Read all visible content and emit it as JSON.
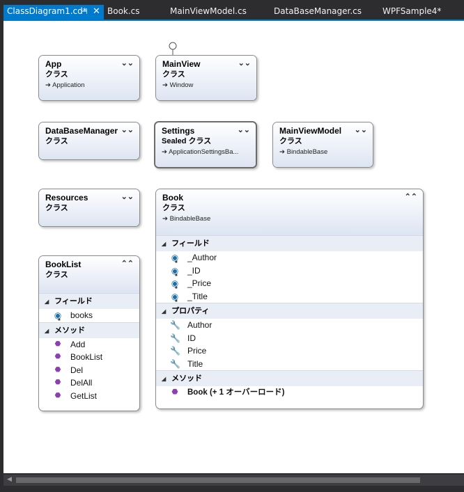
{
  "tabs": [
    {
      "label": "ClassDiagram1.cd*",
      "active": true
    },
    {
      "label": "Book.cs"
    },
    {
      "label": "MainViewModel.cs"
    },
    {
      "label": "DataBaseManager.cs"
    },
    {
      "label": "WPFSample4*"
    }
  ],
  "tab_pin_glyph": "⊣",
  "tab_close_glyph": "✕",
  "classes": {
    "app": {
      "name": "App",
      "kind": "クラス",
      "base": "Application"
    },
    "mainview": {
      "name": "MainView",
      "kind": "クラス",
      "base": "Window"
    },
    "dbmanager": {
      "name": "DataBaseManager",
      "kind": "クラス"
    },
    "settings": {
      "name": "Settings",
      "kind": "Sealed クラス",
      "base": "ApplicationSettingsBa..."
    },
    "mainviewmodel": {
      "name": "MainViewModel",
      "kind": "クラス",
      "base": "BindableBase"
    },
    "resources": {
      "name": "Resources",
      "kind": "クラス"
    },
    "book": {
      "name": "Book",
      "kind": "クラス",
      "base": "BindableBase",
      "fields_label": "フィールド",
      "fields": [
        "_Author",
        "_ID",
        "_Price",
        "_Title"
      ],
      "props_label": "プロパティ",
      "props": [
        "Author",
        "ID",
        "Price",
        "Title"
      ],
      "methods_label": "メソッド",
      "methods": [
        "Book (+ 1 オーバーロード)"
      ]
    },
    "booklist": {
      "name": "BookList",
      "kind": "クラス",
      "fields_label": "フィールド",
      "fields": [
        "books"
      ],
      "methods_label": "メソッド",
      "methods": [
        "Add",
        "BookList",
        "Del",
        "DelAll",
        "GetList"
      ]
    }
  },
  "base_arrow": "➔",
  "colors": {
    "accent": "#007acc",
    "header_grad_end": "#dde4f2",
    "field_icon": "#1c6fa8",
    "method_icon": "#8a3fb3"
  }
}
